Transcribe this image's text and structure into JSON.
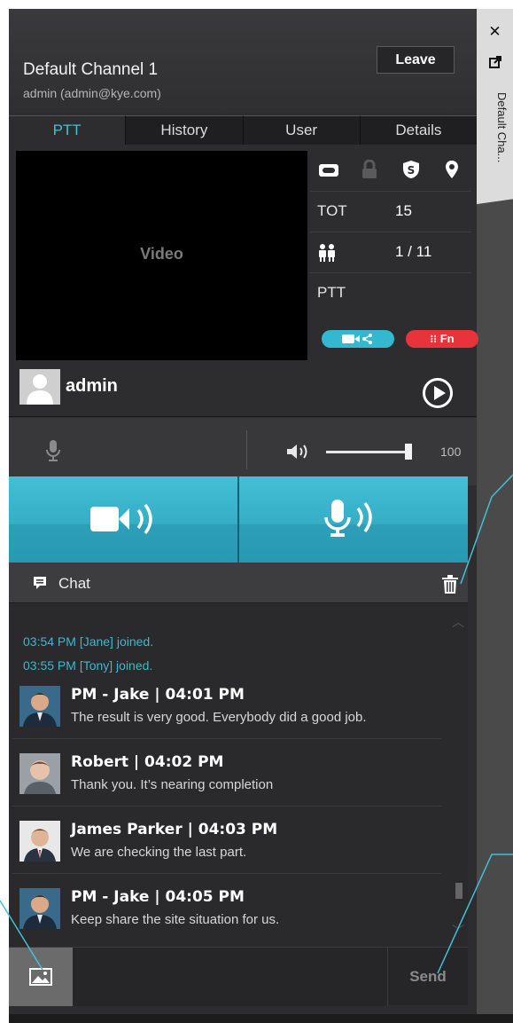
{
  "window": {
    "close_glyph": "✕",
    "popout_glyph": "⧉",
    "side_tab_label": "Default Cha..."
  },
  "header": {
    "channel_name": "Default Channel 1",
    "user_line": "admin (admin@kye.com)",
    "leave_label": "Leave"
  },
  "tabs": [
    {
      "label": "PTT",
      "active": true
    },
    {
      "label": "History",
      "active": false
    },
    {
      "label": "User",
      "active": false
    },
    {
      "label": "Details",
      "active": false
    }
  ],
  "video": {
    "label": "Video"
  },
  "info": {
    "icons": [
      "recorder-icon",
      "lock-icon",
      "security-shield-icon",
      "location-pin-icon"
    ],
    "tot_label": "TOT",
    "tot_value": "15",
    "members_value": "1 / 11",
    "ptt_label": "PTT",
    "fn_label": "Fn"
  },
  "user": {
    "name": "admin"
  },
  "audio": {
    "volume": "100",
    "volume_fraction": 1.0
  },
  "chat": {
    "title": "Chat",
    "system_messages": [
      "03:54 PM [Jane] joined.",
      "03:55 PM [Tony] joined."
    ],
    "messages": [
      {
        "sender": "PM - Jake",
        "time": "| 04:01 PM",
        "text": "The result is very good. Everybody did a good job."
      },
      {
        "sender": "Robert",
        "time": "| 04:02 PM",
        "text": "Thank you. It’s nearing completion"
      },
      {
        "sender": "James Parker",
        "time": "| 04:03 PM",
        "text": "We are checking the last part."
      },
      {
        "sender": "PM - Jake",
        "time": "| 04:05 PM",
        "text": "Keep share the site situation for us."
      }
    ]
  },
  "composer": {
    "send_label": "Send"
  },
  "colors": {
    "accent": "#3fc2d8",
    "fn_red": "#e8333b",
    "panel": "#2d2d2f"
  }
}
